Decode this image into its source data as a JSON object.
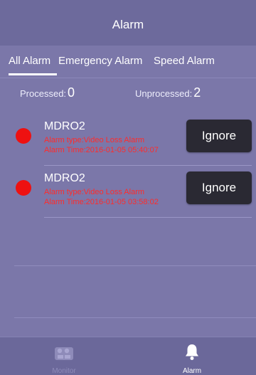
{
  "nav": {
    "title": "Alarm"
  },
  "tabs": [
    {
      "label": "All Alarm"
    },
    {
      "label": "Emergency Alarm"
    },
    {
      "label": "Speed Alarm"
    }
  ],
  "counts": {
    "processed_label": "Processed:",
    "processed_value": "0",
    "unprocessed_label": "Unprocessed:",
    "unprocessed_value": "2"
  },
  "alarms": [
    {
      "device": "MDRO2",
      "type_text": "Alarm type:Video Loss Alarm",
      "time_text": "Alarm Time:2016-01-05 05:40:07",
      "button_label": "Ignore"
    },
    {
      "device": "MDRO2",
      "type_text": "Alarm type:Video Loss Alarm",
      "time_text": "Alarm Time:2016-01-05 03:58:02",
      "button_label": "Ignore"
    }
  ],
  "tab_bar": {
    "items": [
      {
        "label": "Monitor",
        "icon": "monitor-icon"
      },
      {
        "label": "Alarm",
        "icon": "bell-icon"
      }
    ]
  },
  "colors": {
    "background": "#7b77a9",
    "alarm_dot": "#ee1111",
    "alarm_text": "#ff2b2b",
    "button_bg": "#2a2933"
  }
}
